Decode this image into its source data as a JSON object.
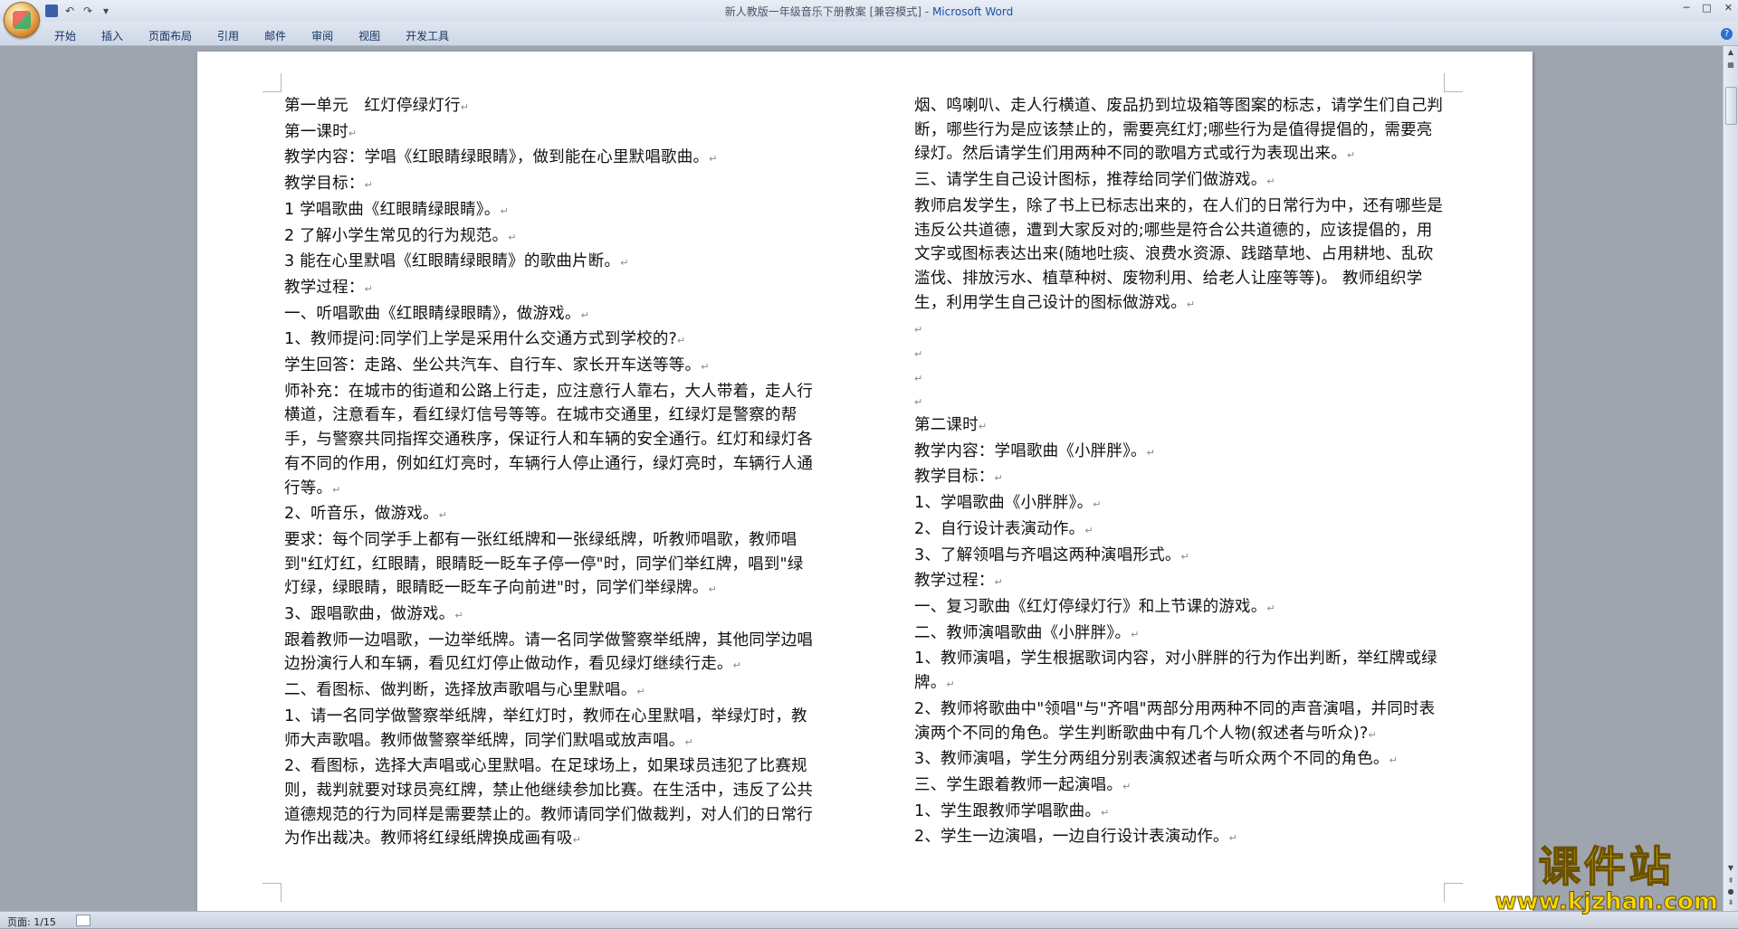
{
  "window": {
    "title": "新人教版一年级音乐下册教案 [兼容模式]",
    "title_sep": " - ",
    "app_name": "Microsoft Word"
  },
  "ribbon": {
    "tabs": [
      "开始",
      "插入",
      "页面布局",
      "引用",
      "邮件",
      "审阅",
      "视图",
      "开发工具"
    ]
  },
  "document": {
    "left_column": [
      "第一单元　红灯停绿灯行",
      "第一课时",
      "教学内容：学唱《红眼睛绿眼睛》，做到能在心里默唱歌曲。",
      "教学目标：",
      "1 学唱歌曲《红眼睛绿眼睛》。",
      "2 了解小学生常见的行为规范。",
      "3 能在心里默唱《红眼睛绿眼睛》的歌曲片断。",
      "教学过程：",
      "一、听唱歌曲《红眼睛绿眼睛》，做游戏。",
      "1、教师提问:同学们上学是采用什么交通方式到学校的?",
      "学生回答：走路、坐公共汽车、自行车、家长开车送等等。",
      "师补充：在城市的街道和公路上行走，应注意行人靠右，大人带着，走人行横道，注意看车，看红绿灯信号等等。在城市交通里，红绿灯是警察的帮手，与警察共同指挥交通秩序，保证行人和车辆的安全通行。红灯和绿灯各有不同的作用，例如红灯亮时，车辆行人停止通行，绿灯亮时，车辆行人通行等。",
      "2、听音乐，做游戏。",
      "要求：每个同学手上都有一张红纸牌和一张绿纸牌，听教师唱歌，教师唱到\"红灯红，红眼睛，眼睛眨一眨车子停一停\"时，同学们举红牌，唱到\"绿灯绿，绿眼睛，眼睛眨一眨车子向前进\"时，同学们举绿牌。",
      "3、跟唱歌曲，做游戏。",
      "跟着教师一边唱歌，一边举纸牌。请一名同学做警察举纸牌，其他同学边唱边扮演行人和车辆，看见红灯停止做动作，看见绿灯继续行走。",
      "二、看图标、做判断，选择放声歌唱与心里默唱。",
      "1、请一名同学做警察举纸牌，举红灯时，教师在心里默唱，举绿灯时，教师大声歌唱。教师做警察举纸牌，同学们默唱或放声唱。",
      "2、看图标，选择大声唱或心里默唱。在足球场上，如果球员违犯了比赛规则，裁判就要对球员亮红牌，禁止他继续参加比赛。在生活中，违反了公共道德规范的行为同样是需要禁止的。教师请同学们做裁判，对人们的日常行为作出裁决。教师将红绿纸牌换成画有吸"
    ],
    "right_column": [
      "烟、鸣喇叭、走人行横道、废品扔到垃圾箱等图案的标志，请学生们自己判断，哪些行为是应该禁止的，需要亮红灯;哪些行为是值得提倡的，需要亮绿灯。然后请学生们用两种不同的歌唱方式或行为表现出来。",
      "三、请学生自己设计图标，推荐给同学们做游戏。",
      "教师启发学生，除了书上已标志出来的，在人们的日常行为中，还有哪些是违反公共道德，遭到大家反对的;哪些是符合公共道德的，应该提倡的，用文字或图标表达出来(随地吐痰、浪费水资源、践踏草地、占用耕地、乱砍滥伐、排放污水、植草种树、废物利用、给老人让座等等)。 教师组织学生，利用学生自己设计的图标做游戏。",
      "",
      "",
      "",
      "",
      "第二课时",
      "教学内容：学唱歌曲《小胖胖》。",
      "教学目标：",
      "1、学唱歌曲《小胖胖》。",
      "2、自行设计表演动作。",
      "3、了解领唱与齐唱这两种演唱形式。",
      "教学过程：",
      "一、复习歌曲《红灯停绿灯行》和上节课的游戏。",
      "二、教师演唱歌曲《小胖胖》。",
      "1、教师演唱，学生根据歌词内容，对小胖胖的行为作出判断，举红牌或绿牌。",
      "2、教师将歌曲中\"领唱\"与\"齐唱\"两部分用两种不同的声音演唱，并同时表演两个不同的角色。学生判断歌曲中有几个人物(叙述者与听众)?",
      "3、教师演唱，学生分两组分别表演叙述者与听众两个不同的角色。",
      "三、学生跟着教师一起演唱。",
      "1、学生跟教师学唱歌曲。",
      "2、学生一边演唱，一边自行设计表演动作。"
    ]
  },
  "status": {
    "page_info": "页面: 1/15"
  },
  "watermark": {
    "name": "课件站",
    "url": "www.kjzhan.com"
  },
  "icons": {
    "office_button": "office-logo-icon",
    "save": "save-icon",
    "undo": "undo-icon",
    "redo": "redo-icon",
    "help": "help-icon"
  }
}
